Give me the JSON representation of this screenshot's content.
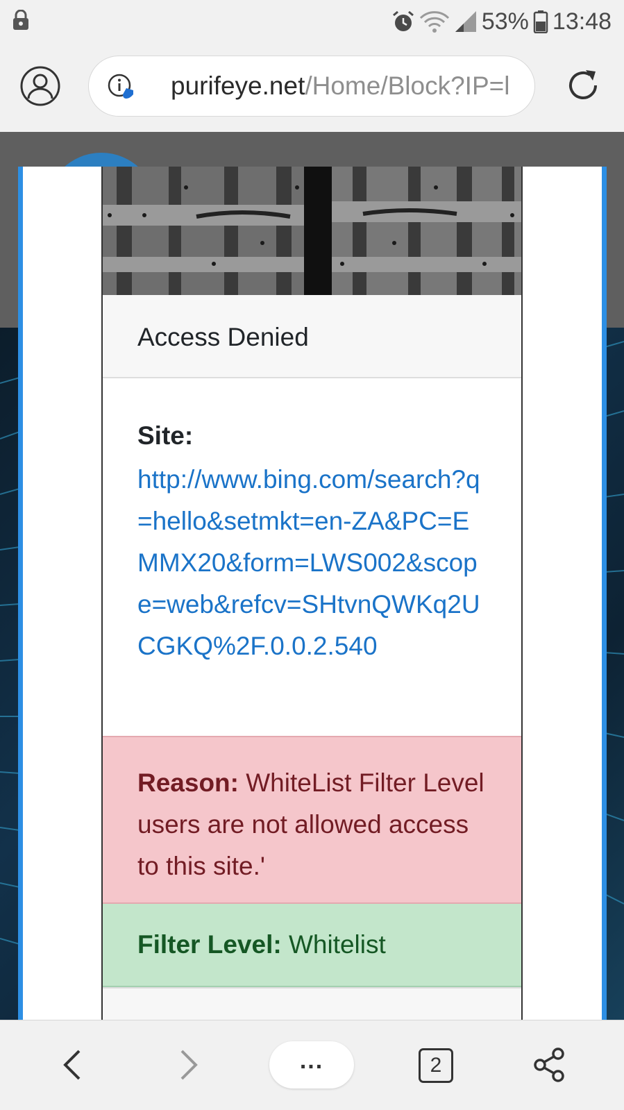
{
  "status_bar": {
    "battery_percent": "53%",
    "time": "13:48",
    "icons": [
      "lock-icon",
      "alarm-icon",
      "wifi-icon",
      "signal-icon",
      "battery-icon"
    ]
  },
  "address_bar": {
    "domain": "purifeye.net",
    "path": "/Home/Block?IP=l",
    "icons": [
      "profile-icon",
      "site-info-icon",
      "reload-icon"
    ]
  },
  "card": {
    "header": "Access Denied",
    "site_label": "Site:",
    "site_url": "http://www.bing.com/search?q=hello&setmkt=en-ZA&PC=EMMX20&form=LWS002&scope=web&refcv=SHtvnQWKq2UCGKQ%2F.0.0.2.540",
    "reason_label": "Reason:",
    "reason_text": " WhiteList Filter Level users are not allowed access to this site.'",
    "filter_label": "Filter Level:",
    "filter_value": " Whitelist"
  },
  "bottom_nav": {
    "menu_label": "...",
    "tab_count": "2",
    "icons": [
      "back-icon",
      "forward-icon",
      "tabs-icon",
      "share-icon"
    ]
  },
  "colors": {
    "link": "#1a73c8",
    "danger_bg": "#f5c6cb",
    "danger_text": "#721c24",
    "success_bg": "#c3e6cb",
    "success_text": "#155724",
    "modal_border": "#2d8fe4"
  }
}
